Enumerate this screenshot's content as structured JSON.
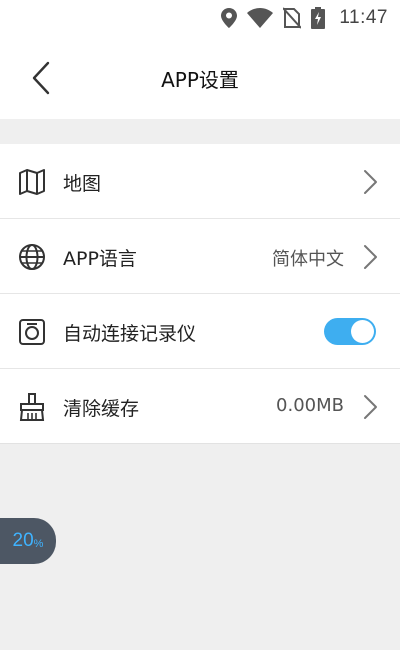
{
  "status_bar": {
    "time": "11:47",
    "icons": [
      "location-icon",
      "wifi-icon",
      "no-sim-icon",
      "battery-charging-icon"
    ]
  },
  "header": {
    "title": "APP设置",
    "back_icon": "chevron-left-icon"
  },
  "settings": [
    {
      "label": "地图",
      "value": "",
      "icon": "map-icon",
      "control": "chevron"
    },
    {
      "label": "APP语言",
      "value": "简体中文",
      "icon": "globe-icon",
      "control": "chevron"
    },
    {
      "label": "自动连接记录仪",
      "value": "",
      "icon": "dashcam-icon",
      "control": "toggle",
      "toggle_on": true
    },
    {
      "label": "清除缓存",
      "value": "0.00MB",
      "icon": "broom-icon",
      "control": "chevron"
    }
  ],
  "floating_badge": {
    "number": "20",
    "unit": "%"
  },
  "colors": {
    "accent": "#3eaef0",
    "background": "#efefef",
    "badge_bg": "#4d5764",
    "badge_text": "#3fb3ff"
  }
}
